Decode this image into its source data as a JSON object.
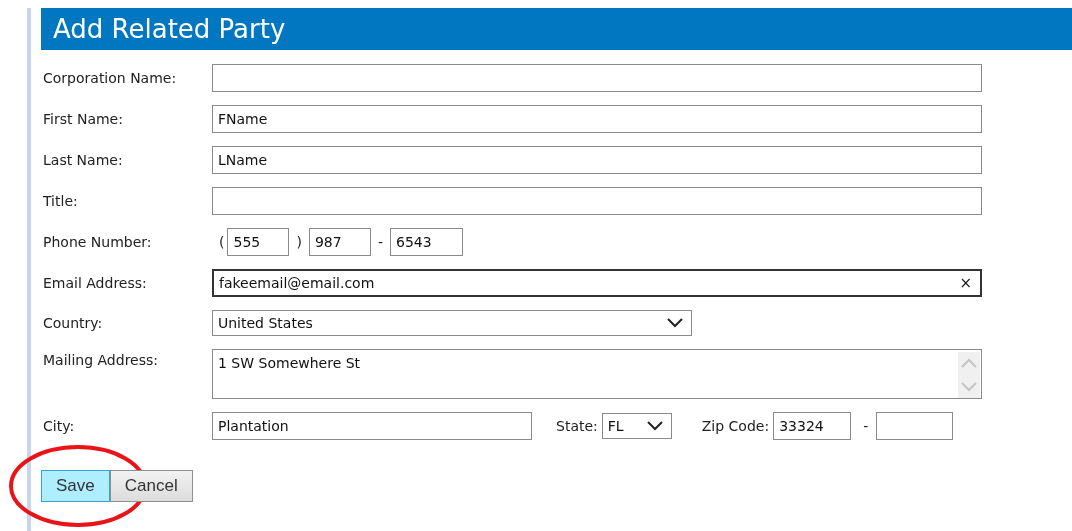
{
  "header": {
    "title": "Add Related Party"
  },
  "fields": [
    {
      "kind": "text",
      "label": "Corporation Name:"
    },
    {
      "kind": "text",
      "label": "First Name:",
      "value": "FName"
    },
    {
      "kind": "text",
      "label": "Last Name:",
      "value": "LName"
    },
    {
      "kind": "text",
      "label": "Title:"
    },
    {
      "kind": "phone",
      "label": "Phone Number:",
      "open": "(",
      "area": "555",
      "close": ")",
      "prefix": "987",
      "dash": "-",
      "line": "6543"
    },
    {
      "kind": "text",
      "label": "Email Address:",
      "value": "fakeemail@email.com",
      "focused": true,
      "clear": "×"
    },
    {
      "kind": "select",
      "label": "Country:",
      "value": "United States"
    },
    {
      "kind": "textarea",
      "label": "Mailing Address:",
      "value": "1 SW Somewhere St"
    },
    {
      "kind": "city",
      "label": "City:",
      "value": "Plantation",
      "state_label": "State:",
      "state": "FL",
      "zip_label": "Zip Code:",
      "zip": "33324",
      "zip_dash": "-"
    }
  ],
  "buttons": [
    {
      "label": "Save",
      "hovered": true,
      "circled": true
    },
    {
      "label": "Cancel",
      "hovered": false,
      "circled": false
    }
  ]
}
